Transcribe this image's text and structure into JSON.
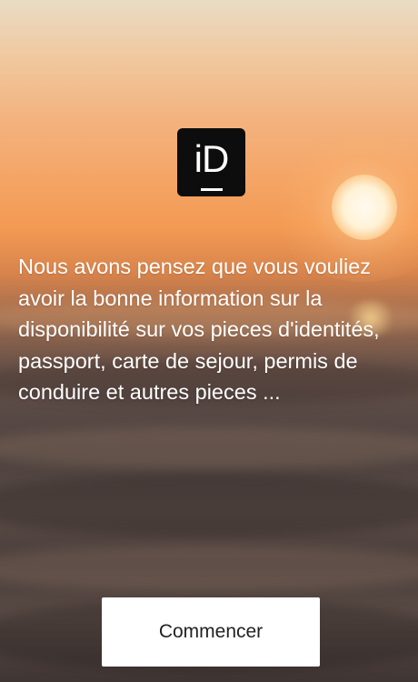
{
  "logo": {
    "text": "iD",
    "icon": "id-logo-icon"
  },
  "intro": {
    "text": "Nous avons pensez que vous vouliez avoir la bonne information sur la disponibilité sur vos pieces d'identités, passport, carte de sejour, permis de conduire et autres pieces ..."
  },
  "start_button": {
    "label": "Commencer"
  },
  "colors": {
    "logo_background": "#0d0d0d",
    "text": "#ffffff",
    "button_background": "#ffffff",
    "button_text": "#222222"
  }
}
